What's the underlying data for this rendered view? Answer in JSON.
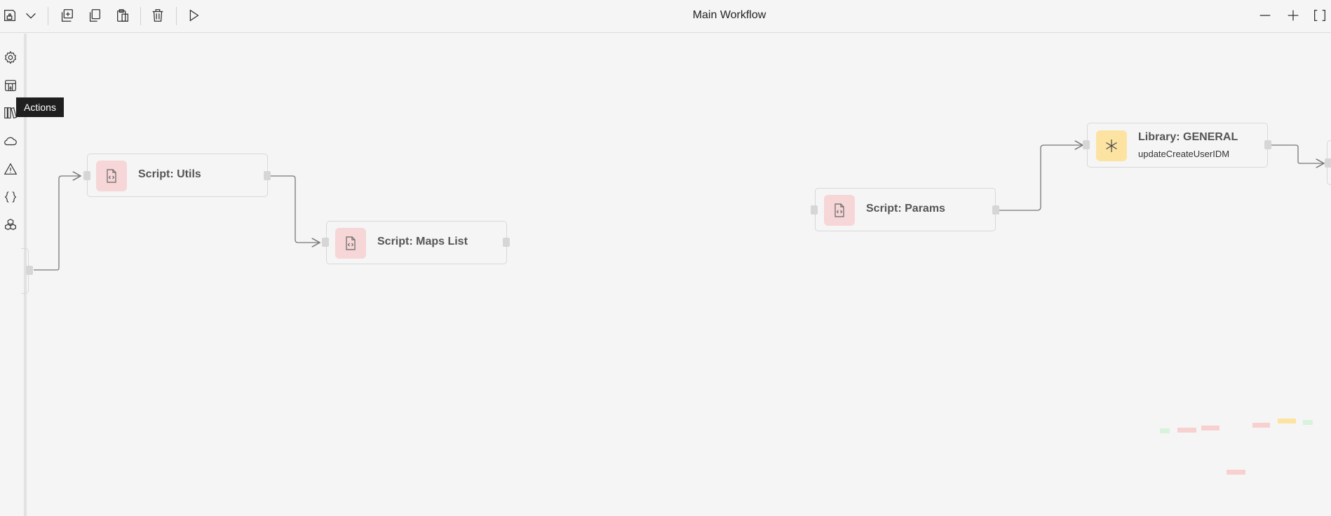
{
  "title": "Main Workflow",
  "tooltip": "Actions",
  "nodes": [
    {
      "label": "Script: Utils"
    },
    {
      "label": "Script: Maps List"
    },
    {
      "label": "Script: Params"
    },
    {
      "label": "Library: GENERAL",
      "sub": "updateCreateUserIDM"
    }
  ],
  "colors": {
    "script": "#f6d6d6",
    "library": "#fce3a1",
    "minimap_red": "#f8d0d0",
    "minimap_yellow": "#fde3a0",
    "minimap_green": "#d8f3dc"
  }
}
